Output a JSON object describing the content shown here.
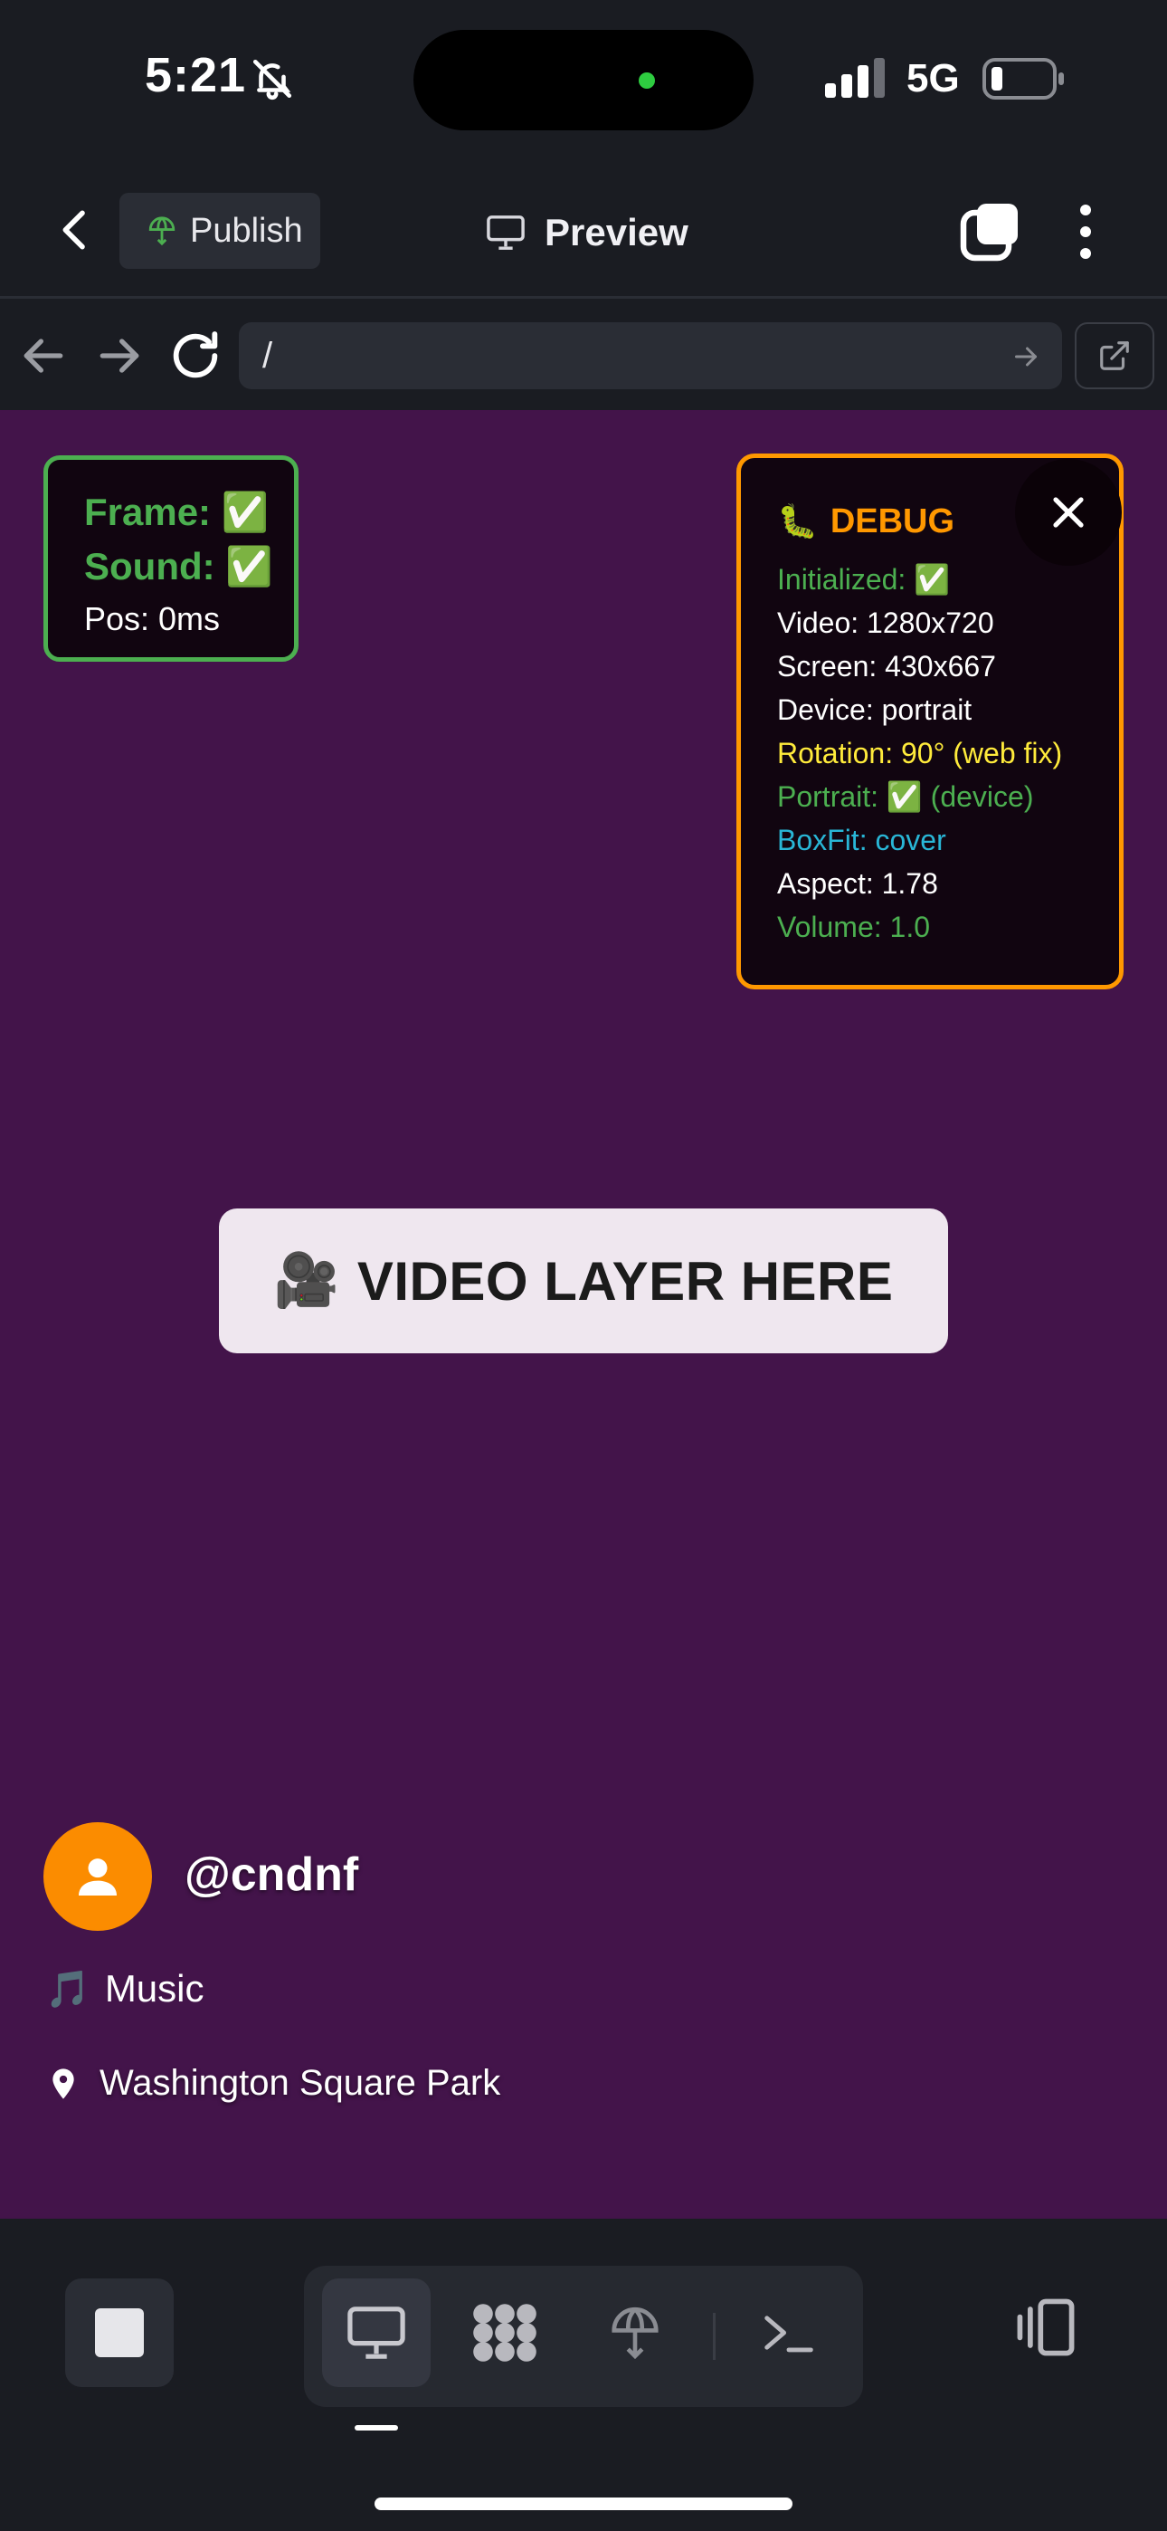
{
  "status_bar": {
    "time": "5:21",
    "network": "5G"
  },
  "header": {
    "publish_label": "Publish",
    "title": "Preview"
  },
  "url_bar": {
    "value": "/"
  },
  "frame_panel": {
    "frame": "Frame: ✅",
    "sound": "Sound: ✅",
    "pos": "Pos: 0ms"
  },
  "debug_panel": {
    "title": "DEBUG",
    "bug_emoji": "🐛",
    "lines": {
      "initialized": "Initialized: ✅",
      "video": "Video: 1280x720",
      "screen": "Screen: 430x667",
      "device": "Device: portrait",
      "rotation": "Rotation: 90° (web fix)",
      "portrait": "Portrait: ✅ (device)",
      "boxfit": "BoxFit: cover",
      "aspect": "Aspect: 1.78",
      "volume": "Volume: 1.0"
    }
  },
  "video_layer": {
    "emoji": "🎥",
    "label": "VIDEO LAYER HERE"
  },
  "profile": {
    "username": "@cndnf",
    "music_emoji": "🎵",
    "music": "Music",
    "location": "Washington Square Park"
  },
  "colors": {
    "viewport_bg": "#43144a",
    "debug_border": "#ff9800",
    "frame_border": "#4caf50",
    "avatar_bg": "#fb8c00",
    "app_bg": "#1a1c22"
  },
  "icons": {
    "status": [
      "bell-slash-icon",
      "signal-icon",
      "battery-icon"
    ],
    "header": [
      "back-chevron-icon",
      "publish-globe-icon",
      "monitor-icon",
      "tabs-icon",
      "more-vertical-icon"
    ],
    "url": [
      "arrow-left-icon",
      "arrow-right-icon",
      "reload-icon",
      "url-go-icon",
      "external-link-icon"
    ],
    "bottom": [
      "stop-icon",
      "monitor-icon",
      "apps-icon",
      "publish-icon",
      "terminal-icon",
      "device-toggle-icon"
    ]
  }
}
